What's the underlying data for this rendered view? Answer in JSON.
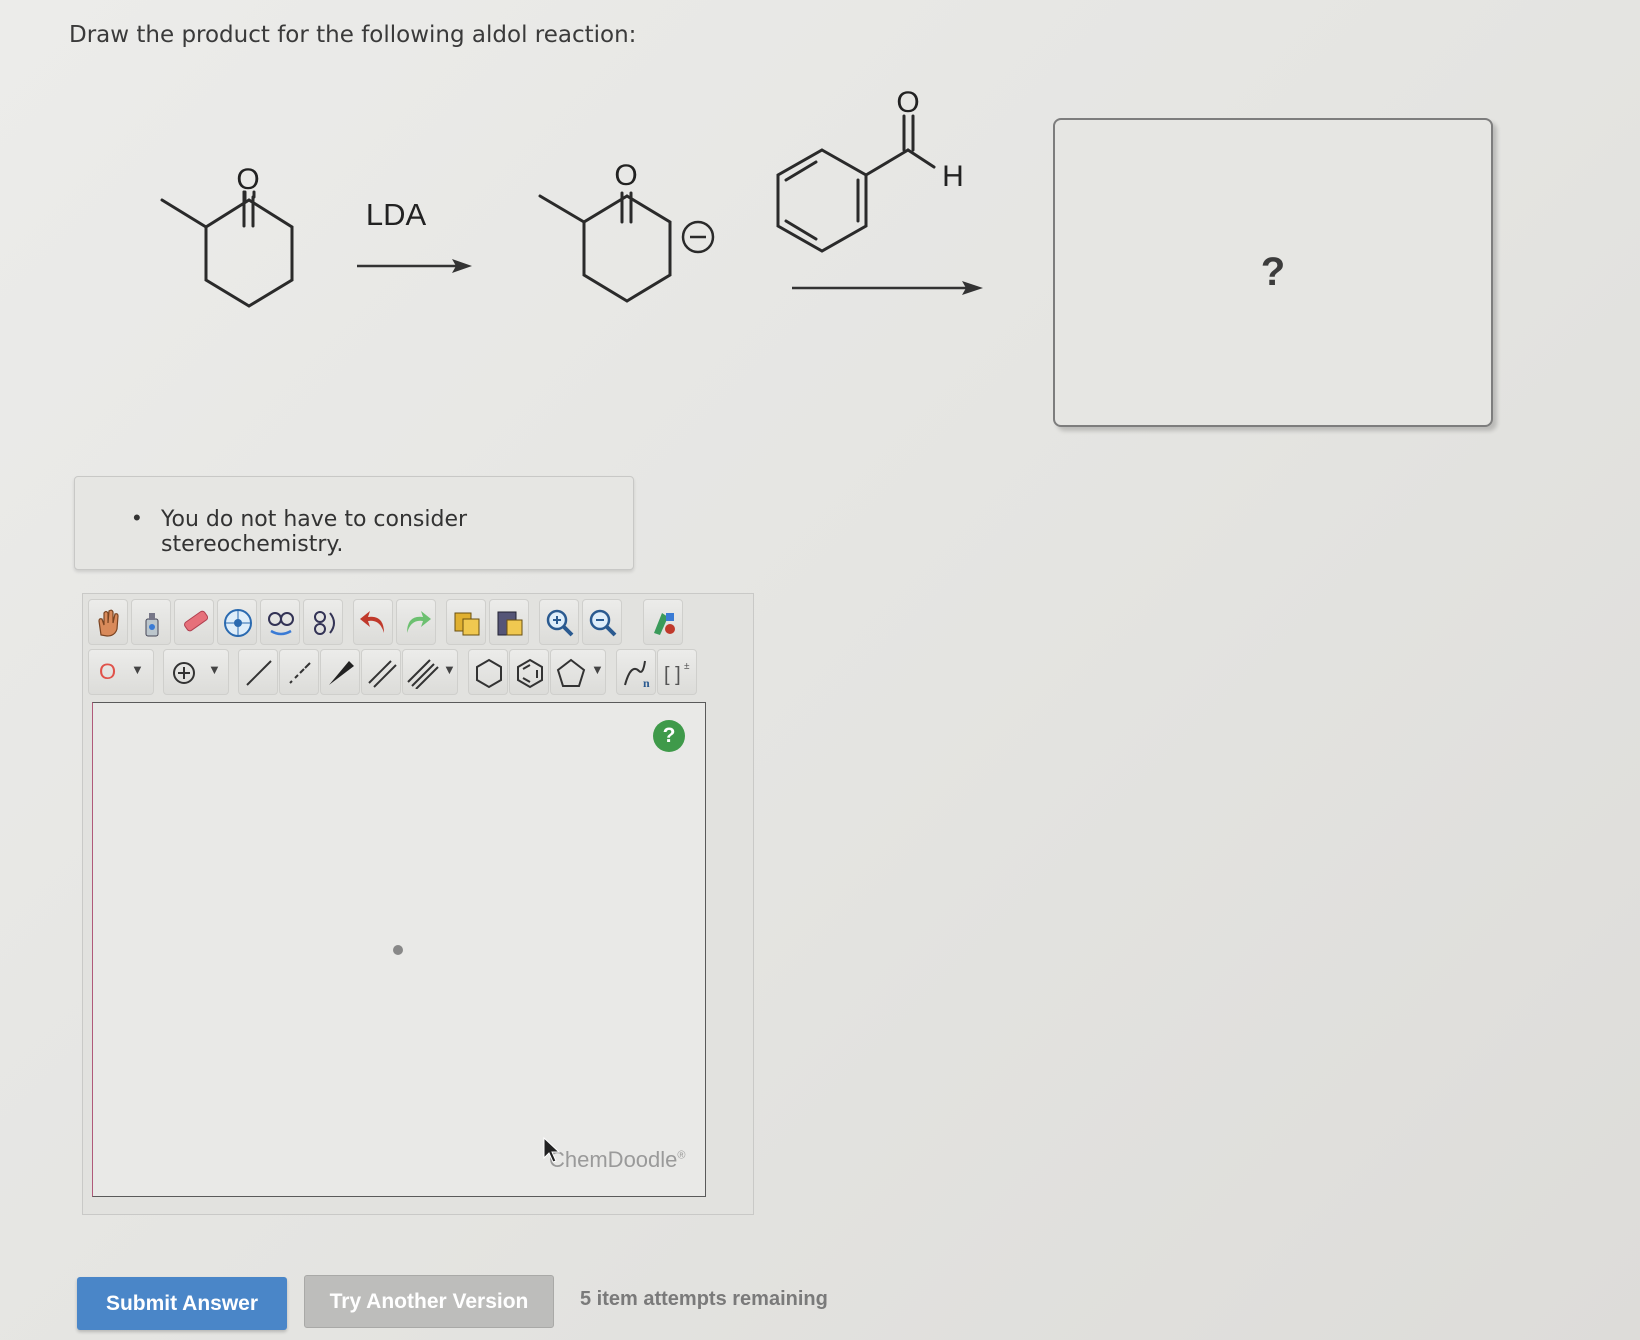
{
  "question": {
    "prompt": "Draw the product for the following aldol reaction:"
  },
  "scheme": {
    "reagent_label": "LDA",
    "atom_O": "O",
    "atom_H": "H",
    "charge_symbol": "−",
    "product_placeholder": "?"
  },
  "hint": {
    "bullet": "•",
    "text": "You do not have to consider stereochemistry."
  },
  "editor": {
    "toolbar_row1": [
      "hand-tool",
      "lasso-tool",
      "eraser-tool",
      "center-tool",
      "flip-tool",
      "rotate-tool",
      "undo",
      "redo",
      "copy",
      "paste",
      "zoom-in",
      "zoom-out",
      "clean-tool"
    ],
    "atom_selector_label": "O",
    "help_label": "?",
    "brand": "ChemDoodle",
    "brand_mark": "®"
  },
  "actions": {
    "submit_label": "Submit Answer",
    "try_another_label": "Try Another Version",
    "attempts_text": "5 item attempts remaining"
  },
  "colors": {
    "submit_bg": "#4a86c8",
    "help_badge": "#3f9a4a",
    "undo_red": "#c0392b",
    "redo_green": "#5cb85c"
  }
}
